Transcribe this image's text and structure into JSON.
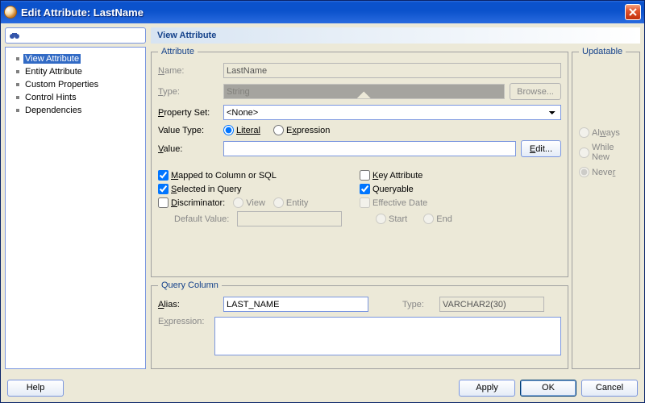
{
  "window": {
    "title": "Edit Attribute: LastName"
  },
  "tree": {
    "items": [
      {
        "label": "View Attribute",
        "selected": true
      },
      {
        "label": "Entity Attribute"
      },
      {
        "label": "Custom Properties"
      },
      {
        "label": "Control Hints"
      },
      {
        "label": "Dependencies"
      }
    ]
  },
  "panel": {
    "title": "View Attribute"
  },
  "attribute": {
    "legend": "Attribute",
    "name_label": "Name:",
    "name_value": "LastName",
    "type_label": "Type:",
    "type_value": "String",
    "browse_label": "Browse...",
    "pset_label": "Property Set:",
    "pset_value": "<None>",
    "vtype_label": "Value Type:",
    "vtype_literal": "Literal",
    "vtype_expression": "Expression",
    "value_label": "Value:",
    "value_value": "",
    "edit_label": "Edit...",
    "checks": {
      "mapped": "Mapped to Column or SQL",
      "selected_in_query": "Selected in Query",
      "discriminator": "Discriminator:",
      "key_attr": "Key Attribute",
      "queryable": "Queryable",
      "eff_date": "Effective Date"
    },
    "disc_view": "View",
    "disc_entity": "Entity",
    "default_value_label": "Default Value:",
    "eff_start": "Start",
    "eff_end": "End"
  },
  "updatable": {
    "legend": "Updatable",
    "always": "Always",
    "while_new": "While New",
    "never": "Never"
  },
  "query_column": {
    "legend": "Query Column",
    "alias_label": "Alias:",
    "alias_value": "LAST_NAME",
    "type_label": "Type:",
    "type_value": "VARCHAR2(30)",
    "expression_label": "Expression:",
    "expression_value": ""
  },
  "buttons": {
    "help": "Help",
    "apply": "Apply",
    "ok": "OK",
    "cancel": "Cancel"
  }
}
